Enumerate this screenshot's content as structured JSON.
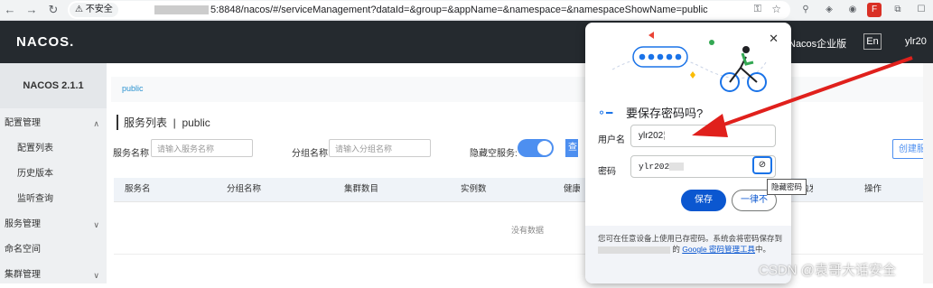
{
  "browser": {
    "security_label": "不安全",
    "url_text": "5:8848/nacos/#/serviceManagement?dataId=&group=&appName=&namespace=&namespaceShowName=public"
  },
  "header": {
    "logo": "NACOS.",
    "enterprise_link": "Nacos企业版",
    "lang_button": "En",
    "user": "ylr20"
  },
  "sidebar": {
    "version": "NACOS 2.1.1",
    "items": [
      {
        "label": "配置管理",
        "type": "group"
      },
      {
        "label": "配置列表",
        "type": "sub"
      },
      {
        "label": "历史版本",
        "type": "sub"
      },
      {
        "label": "监听查询",
        "type": "sub"
      },
      {
        "label": "服务管理",
        "type": "group"
      },
      {
        "label": "命名空间",
        "type": "group"
      },
      {
        "label": "集群管理",
        "type": "group"
      }
    ]
  },
  "main": {
    "breadcrumb": "public",
    "title": "服务列表  |  public",
    "filters": {
      "service_label": "服务名称",
      "service_placeholder": "请输入服务名称",
      "group_label": "分组名称",
      "group_placeholder": "请输入分组名称",
      "hide_empty_label": "隐藏空服务:",
      "query_button": "查询",
      "create_button": "创建服务"
    },
    "table": {
      "columns": [
        "服务名",
        "分组名称",
        "集群数目",
        "实例数",
        "健康实例数",
        "触发保护阈值",
        "操作"
      ],
      "empty_text": "没有数据"
    }
  },
  "password_prompt": {
    "title": "要保存密码吗?",
    "username_label": "用户名",
    "username_value": "ylr202",
    "password_label": "密码",
    "password_value": "ylr202",
    "eye_tooltip": "隐藏密码",
    "save_button": "保存",
    "never_button": "一律不",
    "footer_text_1": "您可在任意设备上使用已存密码。系统会将密码保存到",
    "footer_text_2": "的",
    "footer_link": "Google 密码管理工具",
    "footer_text_3": "中。"
  },
  "watermark": "CSDN @袁哥大话安全"
}
